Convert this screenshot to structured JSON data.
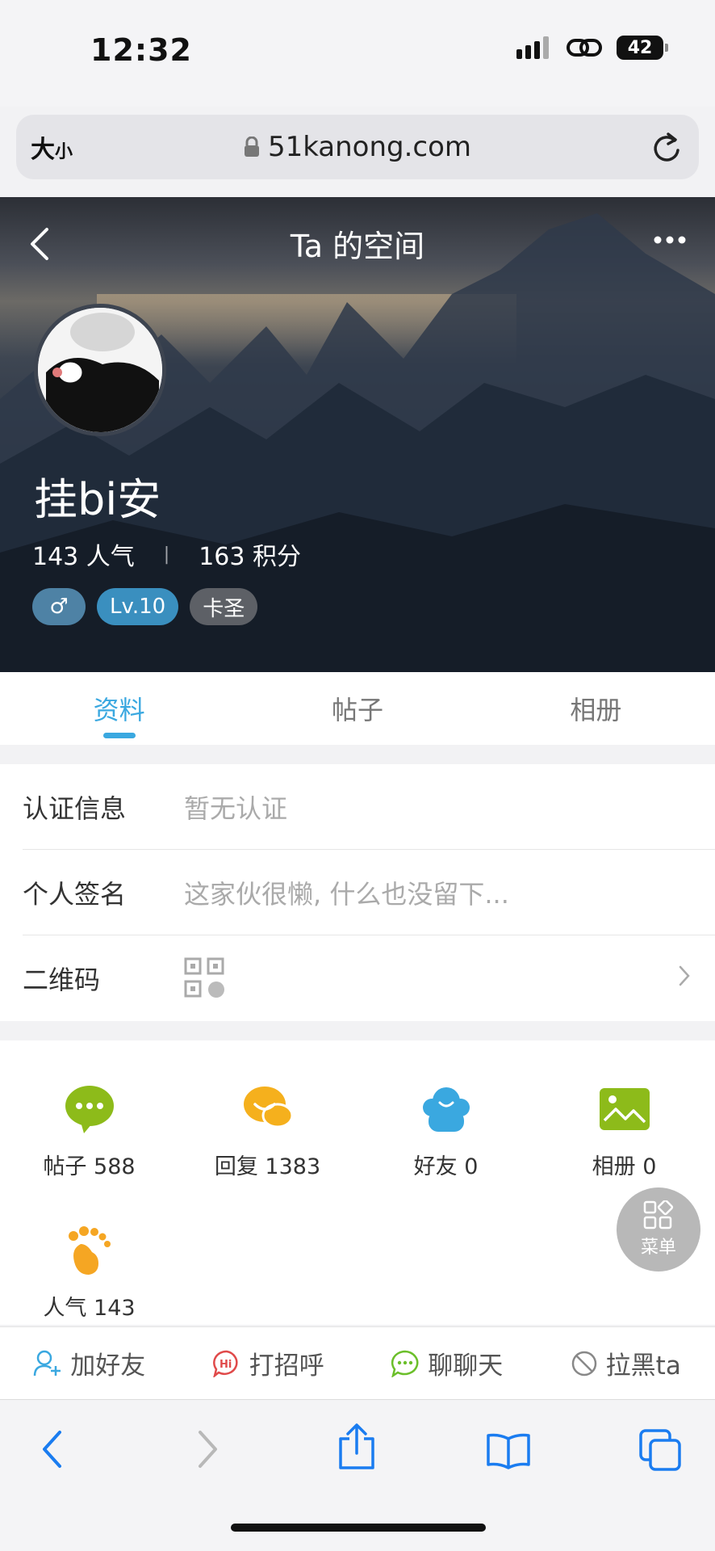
{
  "status_bar": {
    "time": "12:32",
    "battery": "42"
  },
  "browser": {
    "text_size_label": "大",
    "text_size_small": "小",
    "url": "51kanong.com"
  },
  "header": {
    "title": "Ta 的空间",
    "username": "挂bi安",
    "popularity": "143 人气",
    "points": "163 积分",
    "gender_symbol": "♂",
    "level": "Lv.10",
    "rank_title": "卡圣"
  },
  "tabs": [
    {
      "label": "资料",
      "active": true
    },
    {
      "label": "帖子",
      "active": false
    },
    {
      "label": "相册",
      "active": false
    }
  ],
  "info": {
    "cert_label": "认证信息",
    "cert_value": "暂无认证",
    "sign_label": "个人签名",
    "sign_value": "这家伙很懒, 什么也没留下...",
    "qr_label": "二维码"
  },
  "grid": {
    "posts": "帖子 588",
    "replies": "回复 1383",
    "friends": "好友 0",
    "albums": "相册 0",
    "popularity": "人气 143"
  },
  "fab_label": "菜单",
  "actions": {
    "add_friend": "加好友",
    "greet": "打招呼",
    "chat": "聊聊天",
    "block": "拉黑ta"
  },
  "colors": {
    "accent": "#3aa8e0",
    "posts_icon": "#8dbb1a",
    "replies_icon": "#f5b01d",
    "friends_icon": "#3aa8e0",
    "albums_icon": "#8dbb1a",
    "popularity_icon": "#f5a623"
  }
}
